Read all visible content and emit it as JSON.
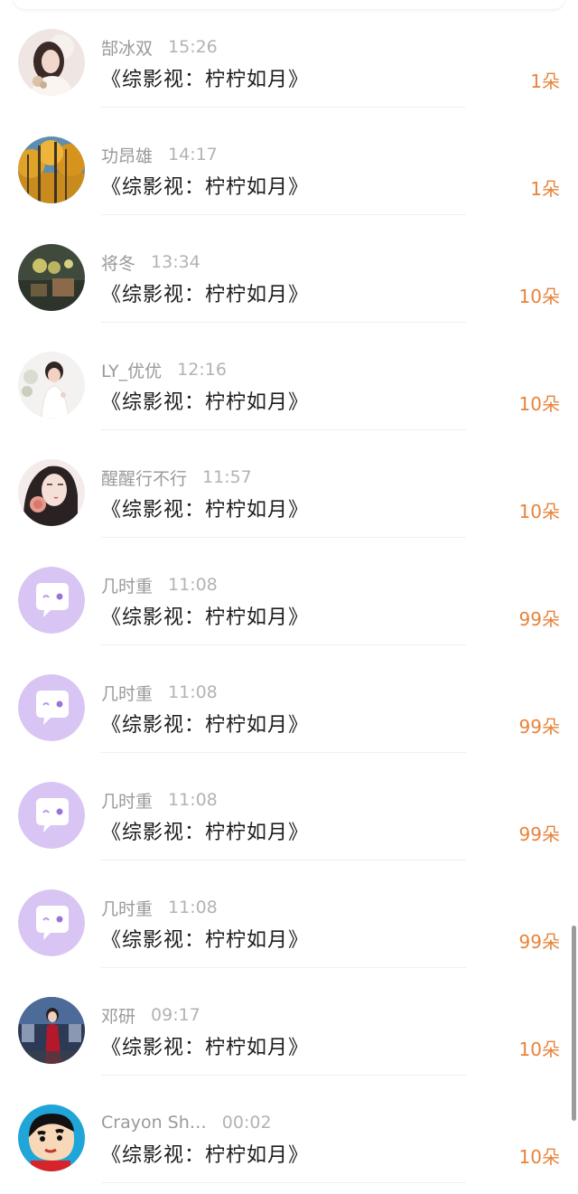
{
  "gift_list": {
    "rows": [
      {
        "name": "郜冰双",
        "time": "15:26",
        "book": "《综影视：柠柠如月》",
        "amount": "1朵",
        "avatar_icon": "portrait-avatar"
      },
      {
        "name": "功昂雄",
        "time": "14:17",
        "book": "《综影视：柠柠如月》",
        "amount": "1朵",
        "avatar_icon": "autumn-forest-avatar"
      },
      {
        "name": "将冬",
        "time": "13:34",
        "book": "《综影视：柠柠如月》",
        "amount": "10朵",
        "avatar_icon": "still-life-avatar"
      },
      {
        "name": "LY_优优",
        "time": "12:16",
        "book": "《综影视：柠柠如月》",
        "amount": "10朵",
        "avatar_icon": "child-portrait-avatar"
      },
      {
        "name": "醒醒行不行",
        "time": "11:57",
        "book": "《综影视：柠柠如月》",
        "amount": "10朵",
        "avatar_icon": "illustrated-girl-avatar"
      },
      {
        "name": "几时重",
        "time": "11:08",
        "book": "《综影视：柠柠如月》",
        "amount": "99朵",
        "avatar_icon": "default-chat-avatar"
      },
      {
        "name": "几时重",
        "time": "11:08",
        "book": "《综影视：柠柠如月》",
        "amount": "99朵",
        "avatar_icon": "default-chat-avatar"
      },
      {
        "name": "几时重",
        "time": "11:08",
        "book": "《综影视：柠柠如月》",
        "amount": "99朵",
        "avatar_icon": "default-chat-avatar"
      },
      {
        "name": "几时重",
        "time": "11:08",
        "book": "《综影视：柠柠如月》",
        "amount": "99朵",
        "avatar_icon": "default-chat-avatar"
      },
      {
        "name": "邓研",
        "time": "09:17",
        "book": "《综影视：柠柠如月》",
        "amount": "10朵",
        "avatar_icon": "red-dress-avatar"
      },
      {
        "name": "Crayon Sh…",
        "time": "00:02",
        "book": "《综影视：柠柠如月》",
        "amount": "10朵",
        "avatar_icon": "cartoon-avatar"
      }
    ]
  },
  "colors": {
    "amount": "#e8833a",
    "name": "#9a9a9a",
    "book_title": "#1c1c1c",
    "default_avatar_bg": "#d9c5f3"
  }
}
